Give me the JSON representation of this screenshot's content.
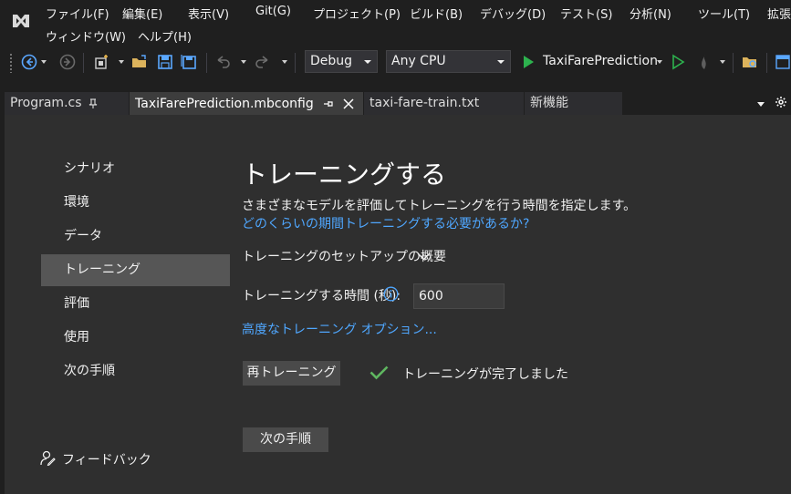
{
  "menu": {
    "items": [
      "ファイル(F)",
      "編集(E)",
      "表示(V)",
      "Git(G)",
      "プロジェクト(P)",
      "ビルド(B)",
      "デバッグ(D)",
      "テスト(S)",
      "分析(N)",
      "ツール(T)",
      "拡張"
    ],
    "row2": [
      "ウィンドウ(W)",
      "ヘルプ(H)"
    ]
  },
  "toolbar": {
    "config": "Debug",
    "platform": "Any CPU",
    "start_target": "TaxiFarePrediction"
  },
  "tabs": [
    {
      "label": "Program.cs"
    },
    {
      "label": "TaxiFarePrediction.mbconfig"
    },
    {
      "label": "taxi-fare-train.txt"
    },
    {
      "label": "新機能"
    }
  ],
  "sidebar": {
    "items": [
      "シナリオ",
      "環境",
      "データ",
      "トレーニング",
      "評価",
      "使用",
      "次の手順"
    ],
    "selected": "トレーニング",
    "feedback": "フィードバック"
  },
  "main": {
    "title": "トレーニングする",
    "description": "さまざまなモデルを評価してトレーニングを行う時間を指定します。",
    "help_link": "どのくらいの期間トレーニングする必要があるか?",
    "setup_summary": "トレーニングのセットアップの概要",
    "time_label": "トレーニングする時間 (秒):",
    "time_value": "600",
    "advanced_link": "高度なトレーニング オプション...",
    "retrain_button": "再トレーニング",
    "status": "トレーニングが完了しました",
    "next_button": "次の手順"
  },
  "colors": {
    "background": "#1f1f1f",
    "content": "#2f2f2f",
    "selected_nav": "#565656",
    "link": "#4fa7ff",
    "check": "#5fb760",
    "play": "#2db24e"
  }
}
